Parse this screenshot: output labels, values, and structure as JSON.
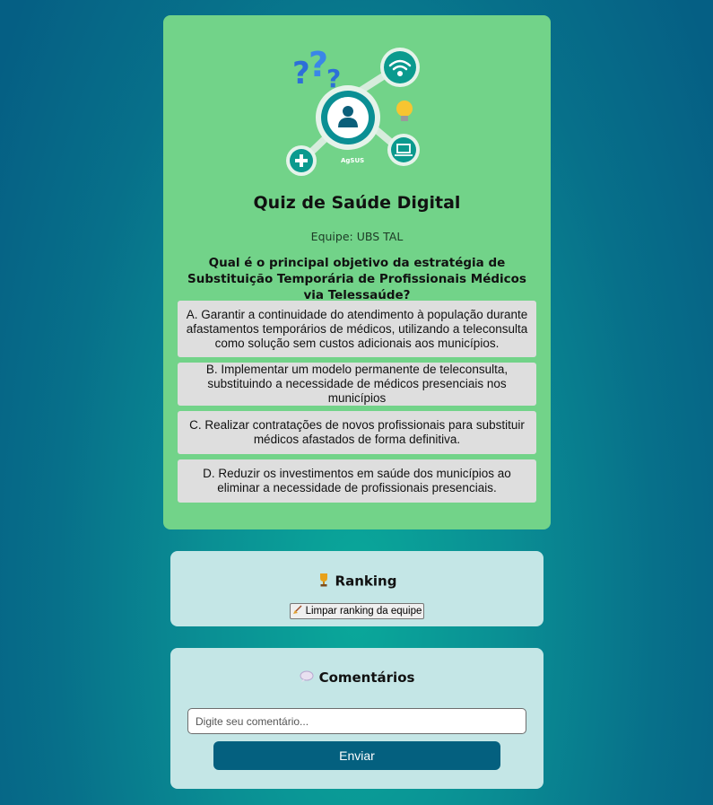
{
  "quiz": {
    "title": "Quiz de Saúde Digital",
    "team": "Equipe: UBS TAL",
    "question": "Qual é o principal objetivo da estratégia de Substituição Temporária de Profissionais Médicos via Telessaúde?",
    "options": [
      {
        "label": "A. Garantir a continuidade do atendimento à população durante afastamentos temporários de médicos, utilizando a teleconsulta como solução sem custos adicionais aos municípios."
      },
      {
        "label": "B. Implementar um modelo permanente de teleconsulta, substituindo a necessidade de médicos presenciais nos municípios"
      },
      {
        "label": "C. Realizar contratações de novos profissionais para substituir médicos afastados de forma definitiva."
      },
      {
        "label": "D. Reduzir os investimentos em saúde dos municípios ao eliminar a necessidade de profissionais presenciais."
      }
    ],
    "logo": {
      "icon": "agsus-telehealth-logo",
      "text": "AgSUS"
    }
  },
  "ranking": {
    "title": "Ranking",
    "icon": "trophy-icon",
    "clear_button": "Limpar ranking da equipe",
    "clear_icon": "broom-icon"
  },
  "comments": {
    "title": "Comentários",
    "icon": "speech-bubble-icon",
    "placeholder": "Digite seu comentário...",
    "send_button": "Enviar"
  },
  "colors": {
    "quiz_card": "#72d389",
    "option_bg": "#dedede",
    "panel_bg": "#c4e6e6",
    "button": "#04607f"
  }
}
